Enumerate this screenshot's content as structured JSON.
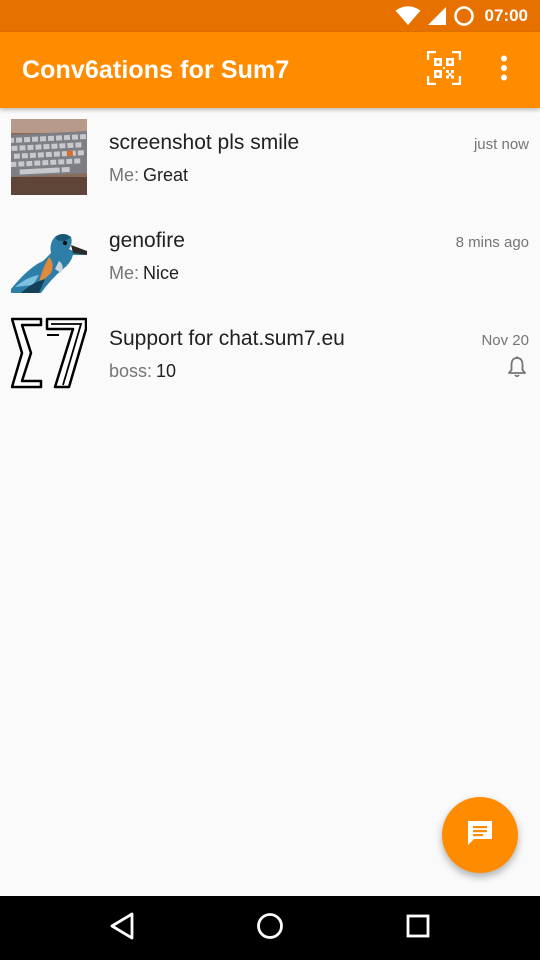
{
  "status_bar": {
    "time": "07:00",
    "icons": [
      "wifi-icon",
      "cell-signal-icon",
      "battery-icon"
    ]
  },
  "toolbar": {
    "title": "Conv6ations for Sum7",
    "actions": [
      "qr-code-icon",
      "overflow-menu-icon"
    ]
  },
  "conversations": [
    {
      "name": "screenshot pls smile",
      "time": "just now",
      "sender": "Me:",
      "preview": "Great",
      "avatar": "keyboard-photo"
    },
    {
      "name": "genofire",
      "time": "8 mins ago",
      "sender": "Me:",
      "preview": "Nice",
      "avatar": "kingfisher-image"
    },
    {
      "name": "Support for chat.sum7.eu",
      "time": "Nov 20",
      "sender": "boss:",
      "preview": "10",
      "avatar": "sum7-logo",
      "notification_icon": "bell-icon"
    }
  ],
  "fab": {
    "icon": "new-message-icon"
  },
  "navigation": [
    "back-icon",
    "home-icon",
    "recents-icon"
  ],
  "colors": {
    "primary": "#ff8c00",
    "primary_dark": "#e67100",
    "background": "#fafafa",
    "text_primary": "#212121",
    "text_secondary": "#757575"
  }
}
